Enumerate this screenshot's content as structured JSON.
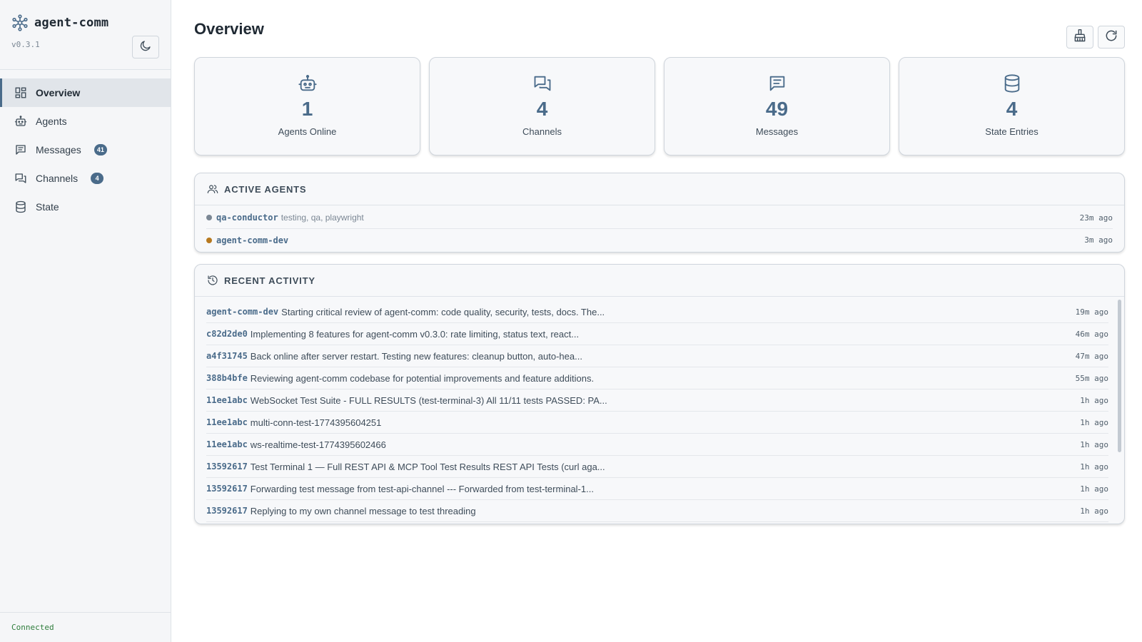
{
  "app": {
    "name": "agent-comm",
    "version": "v0.3.1",
    "status": "Connected"
  },
  "nav": [
    {
      "label": "Overview",
      "icon": "grid-icon",
      "active": true,
      "badge": ""
    },
    {
      "label": "Agents",
      "icon": "robot-icon",
      "active": false,
      "badge": ""
    },
    {
      "label": "Messages",
      "icon": "message-icon",
      "active": false,
      "badge": "41"
    },
    {
      "label": "Channels",
      "icon": "chat-bubbles-icon",
      "active": false,
      "badge": "4"
    },
    {
      "label": "State",
      "icon": "database-icon",
      "active": false,
      "badge": ""
    }
  ],
  "page": {
    "title": "Overview"
  },
  "stats": [
    {
      "value": "1",
      "label": "Agents Online",
      "icon": "robot-icon"
    },
    {
      "value": "4",
      "label": "Channels",
      "icon": "chat-bubbles-icon"
    },
    {
      "value": "49",
      "label": "Messages",
      "icon": "message-icon"
    },
    {
      "value": "4",
      "label": "State Entries",
      "icon": "database-icon"
    }
  ],
  "active_agents": {
    "title": "ACTIVE AGENTS",
    "items": [
      {
        "name": "qa-conductor",
        "tags": "testing, qa, playwright",
        "time": "23m ago",
        "status_color": "#7b8794"
      },
      {
        "name": "agent-comm-dev",
        "tags": "",
        "time": "3m ago",
        "status_color": "#b7791f"
      }
    ]
  },
  "recent_activity": {
    "title": "RECENT ACTIVITY",
    "items": [
      {
        "sender": "agent-comm-dev",
        "text": "Starting critical review of agent-comm: code quality, security, tests, docs. The...",
        "time": "19m ago"
      },
      {
        "sender": "c82d2de0",
        "text": "Implementing 8 features for agent-comm v0.3.0: rate limiting, status text, react...",
        "time": "46m ago"
      },
      {
        "sender": "a4f31745",
        "text": "Back online after server restart. Testing new features: cleanup button, auto-hea...",
        "time": "47m ago"
      },
      {
        "sender": "388b4bfe",
        "text": "Reviewing agent-comm codebase for potential improvements and feature additions.",
        "time": "55m ago"
      },
      {
        "sender": "11ee1abc",
        "text": "WebSocket Test Suite - FULL RESULTS (test-terminal-3) All 11/11 tests PASSED: PA...",
        "time": "1h ago"
      },
      {
        "sender": "11ee1abc",
        "text": "multi-conn-test-1774395604251",
        "time": "1h ago"
      },
      {
        "sender": "11ee1abc",
        "text": "ws-realtime-test-1774395602466",
        "time": "1h ago"
      },
      {
        "sender": "13592617",
        "text": "Test Terminal 1 — Full REST API & MCP Tool Test Results REST API Tests (curl aga...",
        "time": "1h ago"
      },
      {
        "sender": "13592617",
        "text": "Forwarding test message from test-api-channel --- Forwarded from test-terminal-1...",
        "time": "1h ago"
      },
      {
        "sender": "13592617",
        "text": "Replying to my own channel message to test threading",
        "time": "1h ago"
      }
    ]
  },
  "colors": {
    "accent": "#4a6b8a",
    "connected": "#2f7d3c",
    "sidebar_bg": "#f5f6f8"
  }
}
